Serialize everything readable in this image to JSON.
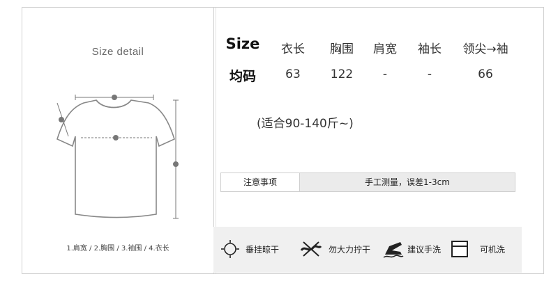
{
  "left": {
    "title": "Size detail",
    "markers": [
      "1",
      "2",
      "3",
      "4"
    ],
    "legend": "1.肩宽 / 2.胸围 / 3.袖围 / 4.衣长"
  },
  "table": {
    "header_label": "Size",
    "columns": [
      "衣长",
      "胸围",
      "肩宽",
      "袖长",
      "领尖→袖"
    ],
    "row_label": "均码",
    "values": [
      "63",
      "122",
      "-",
      "-",
      "66"
    ]
  },
  "fit_note": "(适合90-140斤~)",
  "notice": {
    "label": "注意事项",
    "value": "手工测量，误差1-3cm"
  },
  "care": [
    {
      "icon": "hang-dry-icon",
      "label": "垂挂晾干"
    },
    {
      "icon": "no-wring-icon",
      "label": "勿大力拧干"
    },
    {
      "icon": "hand-wash-icon",
      "label": "建议手洗"
    },
    {
      "icon": "machine-wash-icon",
      "label": "可机洗"
    }
  ]
}
